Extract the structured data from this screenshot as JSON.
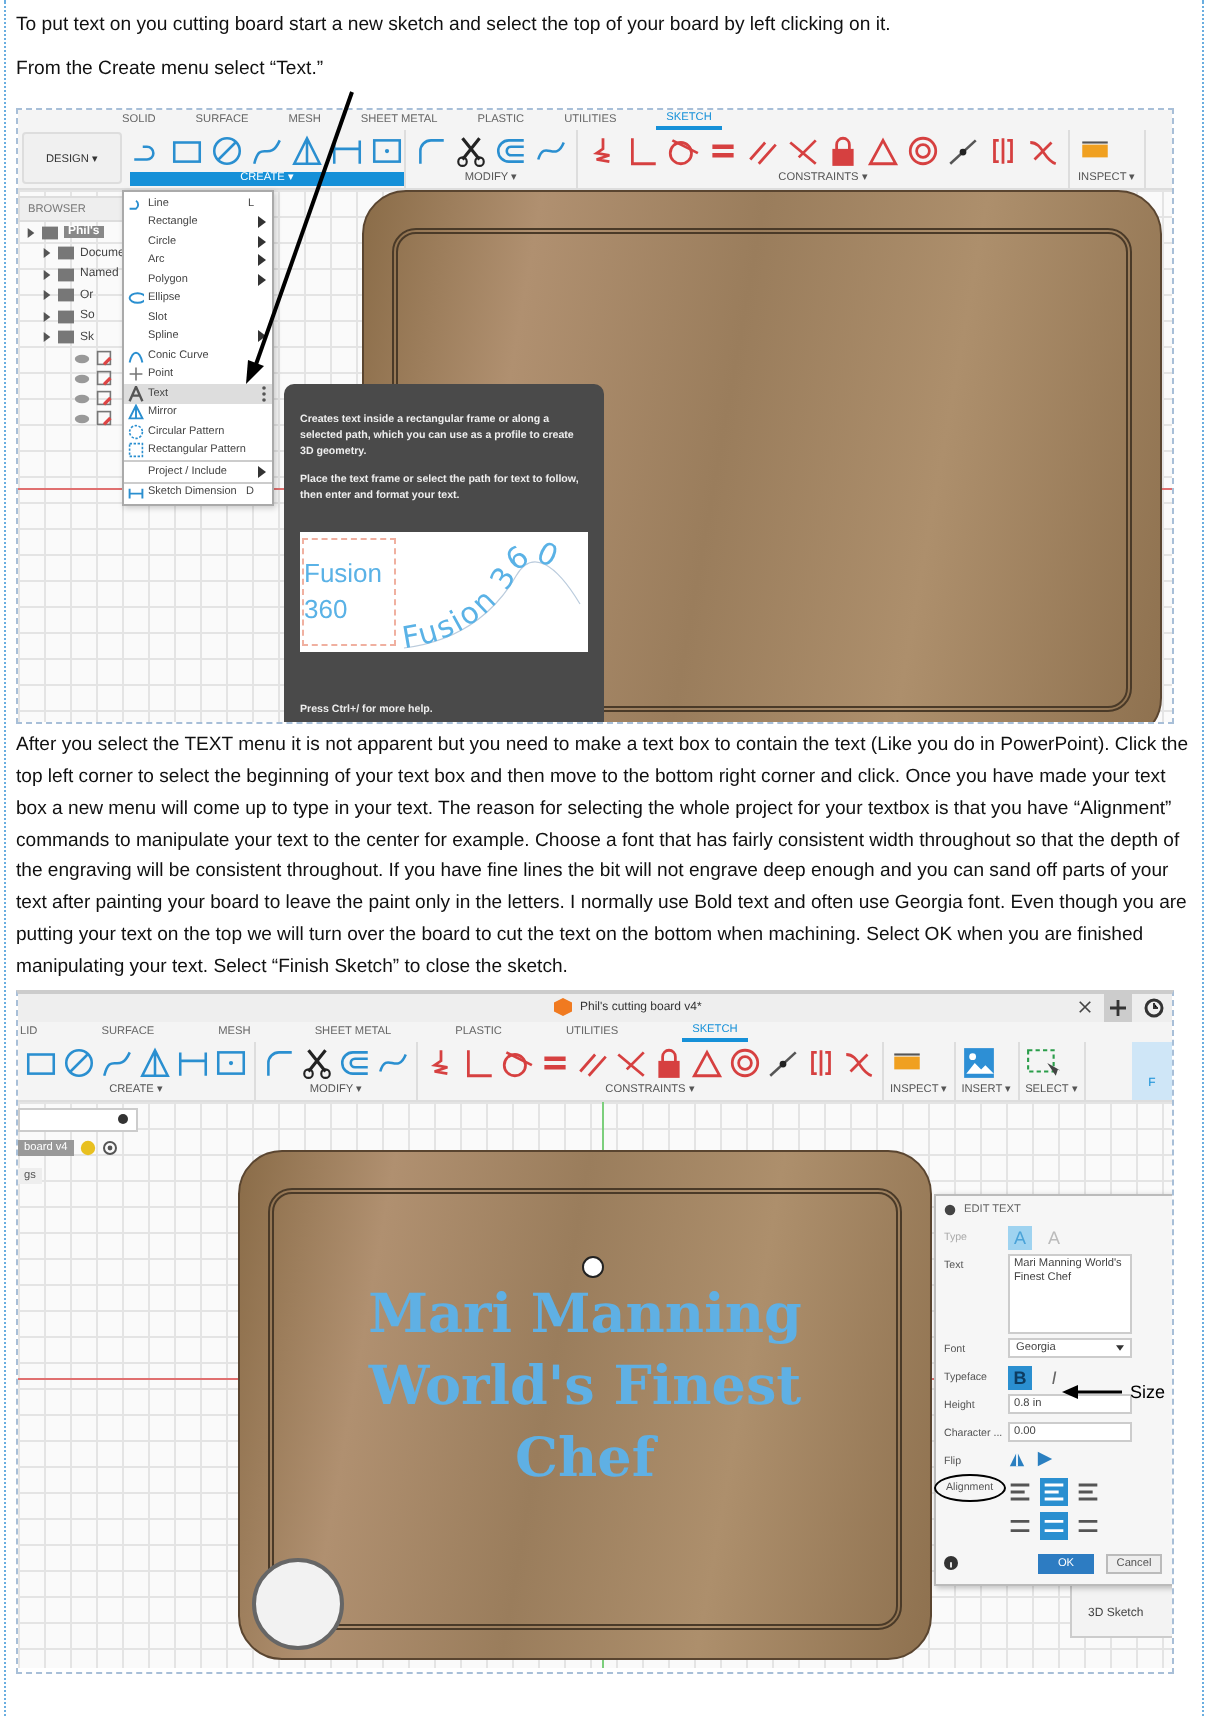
{
  "intro": [
    "To put text on you cutting board start a new sketch and select the top of your board by left clicking on it.",
    "From the Create menu select “Text.”"
  ],
  "screenshot_1": {
    "workspace_button": "DESIGN ▾",
    "tabs": [
      {
        "label": "SOLID",
        "selected": false
      },
      {
        "label": "SURFACE",
        "selected": false
      },
      {
        "label": "MESH",
        "selected": false
      },
      {
        "label": "SHEET METAL",
        "selected": false
      },
      {
        "label": "PLASTIC",
        "selected": false
      },
      {
        "label": "UTILITIES",
        "selected": false
      },
      {
        "label": "SKETCH",
        "selected": true
      }
    ],
    "groups": [
      {
        "label": "CREATE ▾",
        "kind": "create",
        "active": true
      },
      {
        "label": "MODIFY ▾",
        "kind": "modify",
        "active": false
      },
      {
        "label": "CONSTRAINTS ▾",
        "kind": "constraints",
        "active": false
      },
      {
        "label": "INSPECT ▾",
        "kind": "inspect",
        "active": false
      }
    ],
    "browser": {
      "title": "BROWSER",
      "items": [
        {
          "label": "Phil's",
          "selected": true,
          "children": [
            {
              "label": "Docume",
              "selected": false
            },
            {
              "label": "Named",
              "selected": false
            },
            {
              "label": "Or",
              "selected": false
            },
            {
              "label": "So",
              "selected": false
            },
            {
              "label": "Sk",
              "selected": false
            }
          ]
        }
      ]
    },
    "create_menu": [
      {
        "label": "Line",
        "shortcut": "L",
        "submenu": false,
        "selected": false,
        "has_icon": true,
        "group_start": false
      },
      {
        "label": "Rectangle",
        "submenu": true,
        "selected": false,
        "has_icon": false,
        "group_start": false
      },
      {
        "label": "Circle",
        "submenu": true,
        "selected": false,
        "has_icon": false,
        "group_start": false
      },
      {
        "label": "Arc",
        "submenu": true,
        "selected": false,
        "has_icon": false,
        "group_start": false
      },
      {
        "label": "Polygon",
        "submenu": true,
        "selected": false,
        "has_icon": false,
        "group_start": false
      },
      {
        "label": "Ellipse",
        "submenu": false,
        "selected": false,
        "has_icon": true,
        "group_start": false
      },
      {
        "label": "Slot",
        "submenu": false,
        "selected": false,
        "has_icon": false,
        "group_start": false
      },
      {
        "label": "Spline",
        "submenu": true,
        "selected": false,
        "has_icon": false,
        "group_start": false
      },
      {
        "label": "Conic Curve",
        "submenu": false,
        "selected": false,
        "has_icon": true,
        "group_start": false
      },
      {
        "label": "Point",
        "submenu": false,
        "selected": false,
        "has_icon": true,
        "group_start": false
      },
      {
        "label": "Text",
        "submenu": false,
        "selected": true,
        "has_icon": true,
        "group_start": false
      },
      {
        "label": "Mirror",
        "submenu": false,
        "selected": false,
        "has_icon": true,
        "group_start": false
      },
      {
        "label": "Circular Pattern",
        "submenu": false,
        "selected": false,
        "has_icon": true,
        "group_start": false
      },
      {
        "label": "Rectangular Pattern",
        "submenu": false,
        "selected": false,
        "has_icon": true,
        "group_start": false
      },
      {
        "label": "Project / Include",
        "submenu": true,
        "selected": false,
        "has_icon": false,
        "group_start": true
      },
      {
        "label": "Sketch Dimension",
        "shortcut": "D",
        "submenu": false,
        "selected": false,
        "has_icon": true,
        "group_start": true
      }
    ],
    "tooltip": {
      "paragraphs": [
        "Creates text inside a rectangular frame or along a selected path, which you can use as a profile to create 3D geometry.",
        "Place the text frame or select the path for text to follow, then enter and format your text."
      ],
      "frame_text": [
        "Fusion",
        "360"
      ],
      "path_text": "Fusion 360",
      "footer": "Press Ctrl+/ for more help."
    }
  },
  "paragraph": "After you select the TEXT menu it is not apparent but you need to make a text box to contain the text (Like you do in PowerPoint). Click the top left corner to select the beginning of your text box and then move to the bottom right corner and click. Once you have made your text box a new menu will come up to type in your text. The reason for selecting the whole project for your textbox is that you have “Alignment” commands to manipulate your text to the center for example. Choose a font that has fairly consistent width throughout so that the depth of the engraving will be consistent throughout. If you have fine lines the bit will not engrave deep enough and you can sand off parts of your text after painting your board to leave the paint only in the letters. I normally use Bold text and often use Georgia font. Even though you are putting your text on the top we will turn over the board to cut the text on the bottom when machining. Select OK when you are finished manipulating your text. Select “Finish Sketch” to close the sketch.",
  "screenshot_2": {
    "window_title": "Phil's cutting board v4*",
    "tabs": [
      {
        "label": "LID",
        "selected": false
      },
      {
        "label": "SURFACE",
        "selected": false
      },
      {
        "label": "MESH",
        "selected": false
      },
      {
        "label": "SHEET METAL",
        "selected": false
      },
      {
        "label": "PLASTIC",
        "selected": false
      },
      {
        "label": "UTILITIES",
        "selected": false
      },
      {
        "label": "SKETCH",
        "selected": true
      }
    ],
    "groups": [
      {
        "label": "CREATE ▾",
        "kind": "create",
        "active": false
      },
      {
        "label": "MODIFY ▾",
        "kind": "modify",
        "active": false
      },
      {
        "label": "CONSTRAINTS ▾",
        "kind": "constraints",
        "active": false
      },
      {
        "label": "INSPECT ▾",
        "kind": "inspect",
        "active": false
      },
      {
        "label": "INSERT ▾",
        "kind": "insert",
        "active": false
      },
      {
        "label": "SELECT ▾",
        "kind": "select",
        "active": false
      }
    ],
    "finish_button": "F",
    "browser": {
      "root": "board v4",
      "items": [
        "gs"
      ]
    },
    "board_text": [
      "Mari Manning",
      "World's Finest",
      "Chef"
    ],
    "edit_text": {
      "title": "EDIT TEXT",
      "rows": [
        {
          "kind": "toggles",
          "label": "Type",
          "circled": false,
          "options": [
            {
              "label": "A",
              "selected": true
            },
            {
              "label": "A",
              "selected": false
            }
          ]
        },
        {
          "kind": "textarea",
          "label": "Text",
          "circled": false,
          "value": "Mari Manning World's Finest Chef"
        },
        {
          "kind": "select",
          "label": "Font",
          "circled": false,
          "value": "Georgia"
        },
        {
          "kind": "toggles",
          "label": "Typeface",
          "circled": false,
          "options": [
            {
              "label": "B",
              "selected": true
            },
            {
              "label": "I",
              "selected": false
            }
          ]
        },
        {
          "kind": "input",
          "label": "Height",
          "circled": false,
          "value": "0.8 in"
        },
        {
          "kind": "input",
          "label": "Character ...",
          "circled": false,
          "value": "0.00"
        },
        {
          "kind": "flip",
          "label": "Flip",
          "circled": false
        },
        {
          "kind": "alignment",
          "label": "Alignment",
          "circled": true,
          "options": [
            [
              {
                "selected": false
              },
              {
                "selected": true
              },
              {
                "selected": false
              }
            ],
            [
              {
                "selected": false
              },
              {
                "selected": true
              },
              {
                "selected": false
              }
            ]
          ]
        }
      ],
      "ok": "OK",
      "cancel": "Cancel"
    },
    "behind_panel": "3D Sketch",
    "size_note": "Size"
  }
}
